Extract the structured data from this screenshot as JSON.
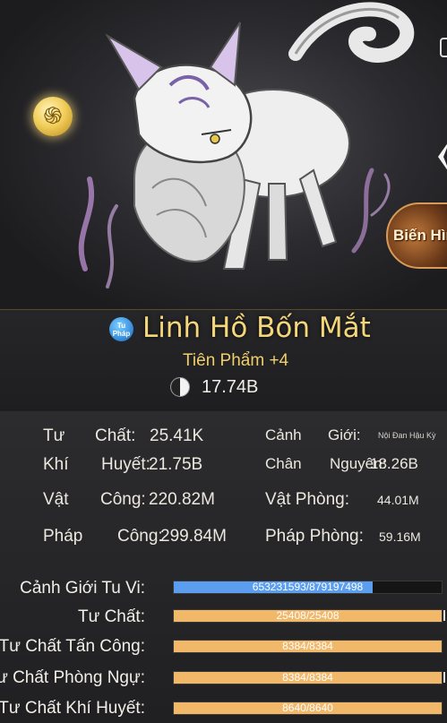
{
  "colors": {
    "accent_gold": "#f4d77a",
    "bar_blue": "#5b9ef0",
    "bar_orange": "#f2b86a",
    "panel_dark": "#262628"
  },
  "hero": {
    "emblem_icon": "gold-coin-icon",
    "transform_button_label": "Biến Hình"
  },
  "pet": {
    "badge_line1": "Tu",
    "badge_line2": "Pháp",
    "name": "Linh Hồ Bốn Mắt",
    "grade": "Tiên Phẩm +4",
    "power_icon": "yin-yang-icon",
    "power": "17.74B"
  },
  "stats": {
    "tu_chat_a": "Tư",
    "tu_chat_b": "Chất:",
    "tu_chat_value": "25.41K",
    "canh_gioi_a": "Cảnh",
    "canh_gioi_b": "Giới:",
    "canh_gioi_value": "Nội Đan Hậu Kỳ",
    "khi_huyet_a": "Khí",
    "khi_huyet_b": "Huyết:",
    "khi_huyet_value": "21.75B",
    "chan_nguyen_a": "Chân",
    "chan_nguyen_b": "Nguyên:",
    "chan_nguyen_value": "18.26B",
    "vat_cong_a": "Vật",
    "vat_cong_b": "Công:",
    "vat_cong_value": "220.82M",
    "vat_phong_label": "Vật Phòng:",
    "vat_phong_value": "44.01M",
    "phap_cong_a": "Pháp",
    "phap_cong_b": "Công:",
    "phap_cong_value": "299.84M",
    "phap_phong_label": "Pháp Phòng:",
    "phap_phong_value": "59.16M"
  },
  "bars": [
    {
      "label": "Cảnh Giới Tu Vi:",
      "text": "653231593/879197498",
      "fill": 0.743,
      "color": "#5b9ef0"
    },
    {
      "label": "Tư Chất:",
      "text": "25408/25408",
      "fill": 1.0,
      "color": "#f2b86a"
    },
    {
      "label": "Tư Chất Tấn Công:",
      "text": "8384/8384",
      "fill": 1.0,
      "color": "#f2b86a"
    },
    {
      "label": "Tư Chất Phòng Ngự:",
      "text": "8384/8384",
      "fill": 1.0,
      "color": "#f2b86a"
    },
    {
      "label": "Tư Chất Khí Huyết:",
      "text": "8640/8640",
      "fill": 1.0,
      "color": "#f2b86a"
    }
  ]
}
